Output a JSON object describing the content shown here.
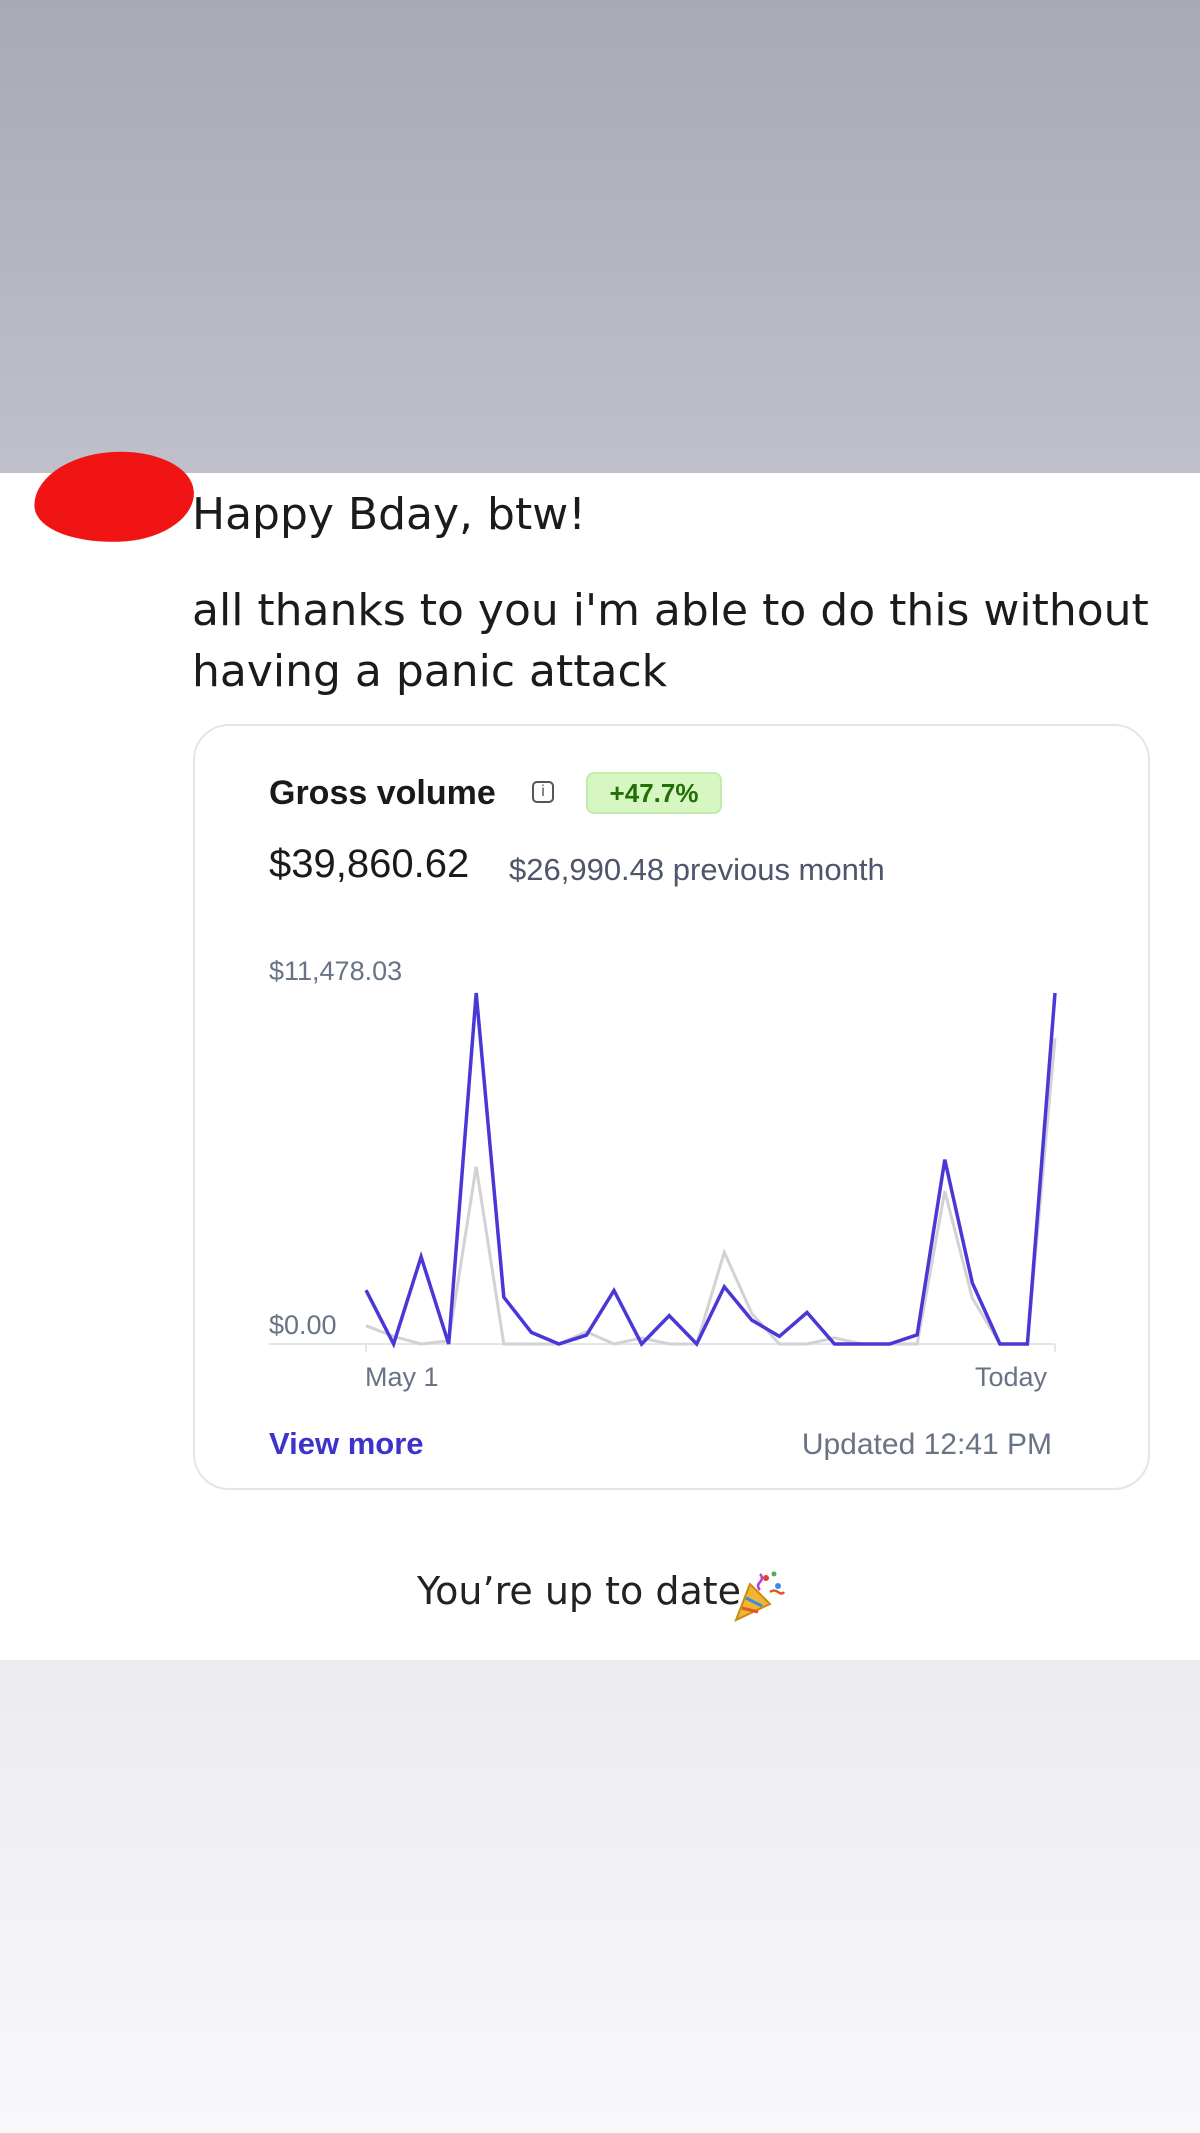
{
  "messages": {
    "first": "Happy Bday, btw!",
    "second": "all thanks to you i'm able to do this without having a panic attack"
  },
  "card": {
    "title": "Gross volume",
    "info_icon": "info-icon",
    "change_badge": "+47.7%",
    "amount": "$39,860.62",
    "previous": "$26,990.48 previous month",
    "view_more": "View more",
    "updated": "Updated 12:41 PM"
  },
  "chart_data": {
    "type": "line",
    "y_max_label": "$11,478.03",
    "y_min_label": "$0.00",
    "x_start_label": "May 1",
    "x_end_label": "Today",
    "ylim": [
      0,
      11478.03
    ],
    "series": [
      {
        "color": "#4a38d6",
        "values": [
          1760,
          0,
          2850,
          0,
          11478.03,
          1530,
          380,
          0,
          290,
          1750,
          0,
          930,
          0,
          1870,
          780,
          250,
          1030,
          0,
          0,
          0,
          300,
          6030,
          2000,
          0,
          0,
          11478.03
        ]
      },
      {
        "color": "#d2d2d6",
        "values": [
          600,
          250,
          0,
          100,
          5800,
          0,
          0,
          0,
          400,
          0,
          200,
          0,
          0,
          3000,
          1000,
          0,
          0,
          200,
          0,
          0,
          0,
          5000,
          1500,
          0,
          0,
          10000
        ]
      }
    ]
  },
  "footer": {
    "status": "You’re up to date",
    "party_icon": "party-popper-icon"
  },
  "colors": {
    "accent": "#3d33cc",
    "badge_bg": "#d7f7c2",
    "badge_text": "#217005"
  }
}
